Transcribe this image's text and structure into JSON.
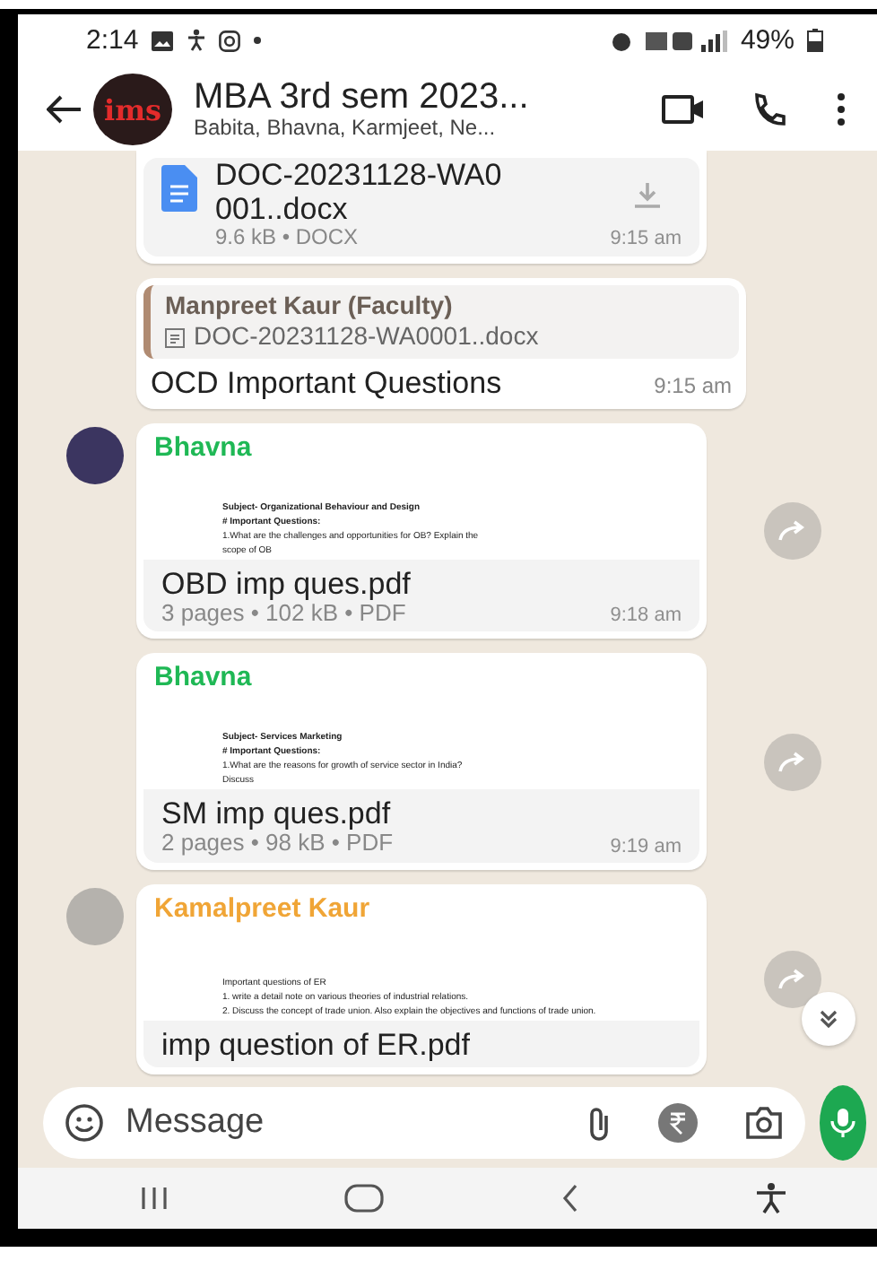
{
  "status_bar": {
    "time": "2:14",
    "battery": "49%"
  },
  "header": {
    "logo_text": "ims",
    "title": "MBA 3rd sem 2023...",
    "subtitle": "Babita, Bhavna, Karmjeet, Ne..."
  },
  "messages": [
    {
      "kind": "document",
      "name_lines": [
        "DOC-20231128-WA0",
        "001..docx"
      ],
      "meta": "9.6 kB • DOCX",
      "time": "9:15 am"
    },
    {
      "kind": "reply",
      "quote_author": "Manpreet Kaur (Faculty)",
      "quote_file": "DOC-20231128-WA0001..docx",
      "text": "OCD Important Questions",
      "time": "9:15 am"
    },
    {
      "kind": "pdf",
      "avatar": true,
      "sender": "Bhavna",
      "color": "#1fb855",
      "preview_lines": [
        {
          "text": "Subject- Organizational Behaviour and Design",
          "bold": true
        },
        {
          "text": "# Important Questions:",
          "bold": true
        },
        {
          "text": "1.What are the challenges and opportunities for OB? Explain the",
          "bold": false
        },
        {
          "text": "scope of OB",
          "bold": false
        }
      ],
      "file_name": "OBD imp ques.pdf",
      "meta": "3 pages • 102 kB • PDF",
      "time": "9:18 am"
    },
    {
      "kind": "pdf",
      "avatar": false,
      "sender": "Bhavna",
      "color": "#1fb855",
      "preview_lines": [
        {
          "text": "Subject- Services Marketing",
          "bold": true
        },
        {
          "text": "# Important Questions:",
          "bold": true
        },
        {
          "text": "1.What are the reasons for growth of service sector in India?",
          "bold": false
        },
        {
          "text": "Discuss",
          "bold": false
        }
      ],
      "file_name": "SM imp ques.pdf",
      "meta": "2 pages • 98 kB • PDF",
      "time": "9:19 am"
    },
    {
      "kind": "pdf",
      "avatar": true,
      "sender": "Kamalpreet Kaur",
      "color": "#f0a536",
      "preview_lines": [
        {
          "text": "Important questions of ER",
          "bold": false
        },
        {
          "text": "1. write a detail note on various theories of industrial relations.",
          "bold": false
        },
        {
          "text": "2. Discuss the concept of trade union. Also explain the objectives and functions of trade union.",
          "bold": false
        }
      ],
      "file_name": "imp question of ER.pdf"
    }
  ],
  "composer": {
    "placeholder": "Message"
  }
}
